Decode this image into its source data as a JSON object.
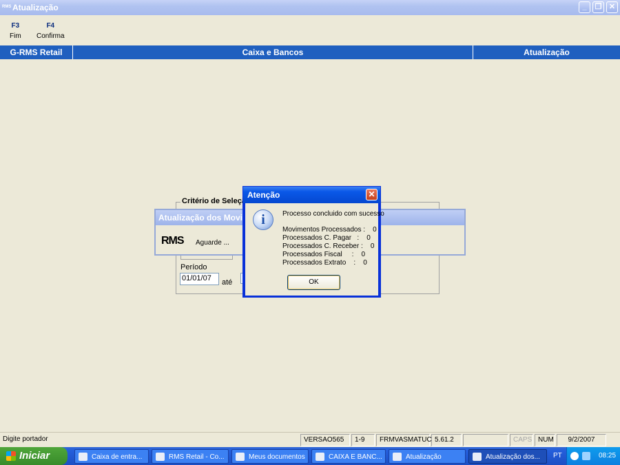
{
  "window": {
    "title": "Atualização",
    "app_icon_text": "RMS"
  },
  "toolbar": {
    "f3_key": "F3",
    "f3_label": "Fim",
    "f4_key": "F4",
    "f4_label": "Confirma"
  },
  "header": {
    "left": "G-RMS Retail",
    "center": "Caixa e Bancos",
    "right": "Atualização"
  },
  "form": {
    "group_title": "Critério de Seleção",
    "periodo_label": "Período",
    "date_from": "01/01/07",
    "ate_label": "até"
  },
  "progress_window": {
    "title": "Atualização dos Movimentos",
    "logo": "RMS",
    "status": "Aguarde ..."
  },
  "dialog": {
    "title": "Atenção",
    "message": "Processo concluido com sucesso",
    "lines": [
      "Movimentos Processados :    0",
      "Processados C. Pagar   :    0",
      "Processados C. Receber :    0",
      "Processados Fiscal     :    0",
      "Processados Extrato    :    0"
    ],
    "ok_label": "OK"
  },
  "statusbar": {
    "message": "Digite portador",
    "version": "VERSAO565",
    "page": "1-9",
    "form_name": "FRMVASMATUC",
    "build": "5.61.2",
    "caps": "CAPS",
    "num": "NUM",
    "date": "9/2/2007"
  },
  "taskbar": {
    "start_label": "Iniciar",
    "tasks": [
      "Caixa de entra...",
      "RMS Retail - Co...",
      "Meus documentos",
      "CAIXA E BANC...",
      "Atualização",
      "Atualização dos..."
    ],
    "lang": "PT",
    "clock": "08:25"
  },
  "colors": {
    "header_band": "#1f5fbf",
    "dialog_border": "#0831d9",
    "desktop": "#ece9d8"
  }
}
